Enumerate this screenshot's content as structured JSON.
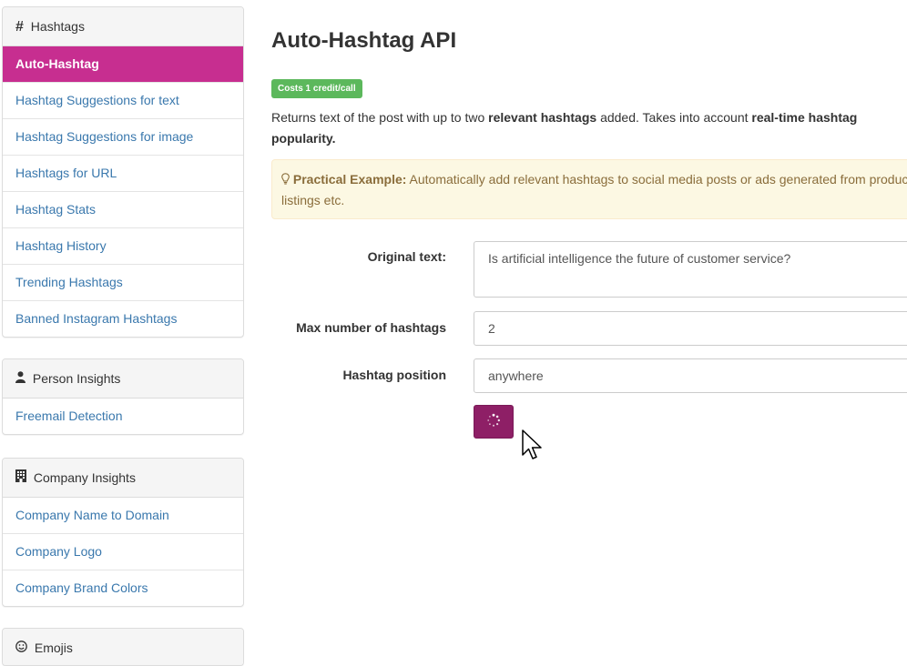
{
  "sidebar": {
    "hashtags": {
      "title_icon": "#",
      "title": "Hashtags",
      "items": [
        {
          "label": "Auto-Hashtag",
          "active": true
        },
        {
          "label": "Hashtag Suggestions for text"
        },
        {
          "label": "Hashtag Suggestions for image"
        },
        {
          "label": "Hashtags for URL"
        },
        {
          "label": "Hashtag Stats"
        },
        {
          "label": "Hashtag History"
        },
        {
          "label": "Trending Hashtags"
        },
        {
          "label": "Banned Instagram Hashtags"
        }
      ]
    },
    "person": {
      "title_icon": "user-icon",
      "title": "Person Insights",
      "items": [
        {
          "label": "Freemail Detection"
        }
      ]
    },
    "company": {
      "title_icon": "building-icon",
      "title": "Company Insights",
      "items": [
        {
          "label": "Company Name to Domain"
        },
        {
          "label": "Company Logo"
        },
        {
          "label": "Company Brand Colors"
        }
      ]
    },
    "emojis": {
      "title_icon": "smiley-icon",
      "title": "Emojis"
    }
  },
  "main": {
    "title": "Auto-Hashtag API",
    "badge": "Costs 1 credit/call",
    "description": {
      "p1": "Returns text of the post with up to two ",
      "b1": "relevant hashtags",
      "p2": " added. Takes into account ",
      "b2": "real-time hashtag popularity."
    },
    "example": {
      "icon": "lightbulb-icon",
      "label": "Practical Example:",
      "text": " Automatically add relevant hashtags to social media posts or ads generated from product listings etc."
    },
    "form": {
      "original_text_label": "Original text:",
      "original_text_value": "Is artificial intelligence the future of customer service?",
      "max_hashtags_label": "Max number of hashtags",
      "max_hashtags_value": "2",
      "position_label": "Hashtag position",
      "position_value": "anywhere",
      "submit_icon": "spinner-icon"
    }
  },
  "colors": {
    "active_item": "#c72e90",
    "submit_button": "#8e1f66",
    "badge": "#5cb85c",
    "link": "#3a78ad",
    "alert_bg": "#fcf8e3"
  }
}
